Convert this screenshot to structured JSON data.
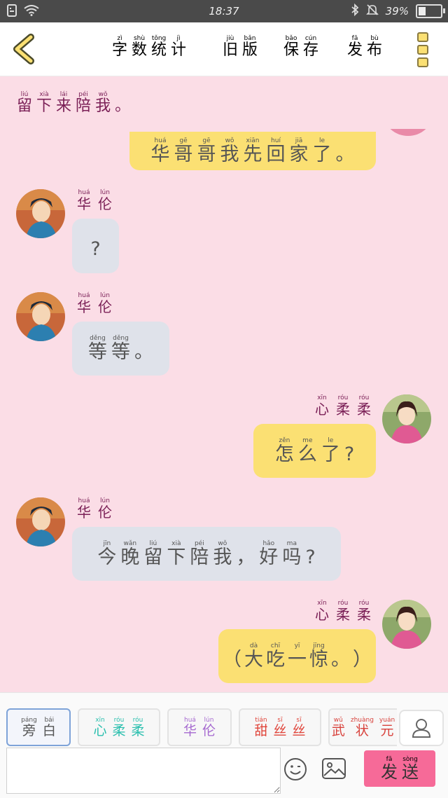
{
  "status_bar": {
    "time": "18:37",
    "battery": "39%",
    "battery_level": 0.39
  },
  "header": {
    "items": [
      {
        "chars": [
          {
            "py": "zì",
            "hz": "字"
          },
          {
            "py": "shù",
            "hz": "数"
          },
          {
            "py": "tǒng",
            "hz": "统"
          },
          {
            "py": "jì",
            "hz": "计"
          }
        ]
      },
      {
        "chars": [
          {
            "py": "jiù",
            "hz": "旧"
          },
          {
            "py": "bǎn",
            "hz": "版"
          }
        ]
      },
      {
        "chars": [
          {
            "py": "bǎo",
            "hz": "保"
          },
          {
            "py": "cún",
            "hz": "存"
          }
        ]
      },
      {
        "chars": [
          {
            "py": "fā",
            "hz": "发"
          },
          {
            "py": "bù",
            "hz": "布"
          }
        ]
      }
    ]
  },
  "intro": [
    {
      "py": "liú",
      "hz": "留"
    },
    {
      "py": "xià",
      "hz": "下"
    },
    {
      "py": "lái",
      "hz": "来"
    },
    {
      "py": "péi",
      "hz": "陪"
    },
    {
      "py": "wǒ",
      "hz": "我"
    },
    {
      "py": "",
      "hz": "。"
    }
  ],
  "names": {
    "hualun": [
      {
        "py": "huá",
        "hz": "华"
      },
      {
        "py": "lún",
        "hz": "伦"
      }
    ],
    "xinrourou": [
      {
        "py": "xīn",
        "hz": "心"
      },
      {
        "py": "róu",
        "hz": "柔"
      },
      {
        "py": "róu",
        "hz": "柔"
      }
    ]
  },
  "messages": [
    {
      "side": "right",
      "chars": [
        {
          "py": "huá",
          "hz": "华"
        },
        {
          "py": "gē",
          "hz": "哥"
        },
        {
          "py": "gē",
          "hz": "哥"
        },
        {
          "py": "wǒ",
          "hz": "我"
        },
        {
          "py": "xiān",
          "hz": "先"
        },
        {
          "py": "huí",
          "hz": "回"
        },
        {
          "py": "jiā",
          "hz": "家"
        },
        {
          "py": "le",
          "hz": "了"
        },
        {
          "py": "",
          "hz": "。"
        }
      ]
    },
    {
      "side": "left",
      "chars": [
        {
          "py": "",
          "hz": "?"
        }
      ]
    },
    {
      "side": "left",
      "chars": [
        {
          "py": "děng",
          "hz": "等"
        },
        {
          "py": "děng",
          "hz": "等"
        },
        {
          "py": "",
          "hz": "。"
        }
      ]
    },
    {
      "side": "right",
      "chars": [
        {
          "py": "zěn",
          "hz": "怎"
        },
        {
          "py": "me",
          "hz": "么"
        },
        {
          "py": "le",
          "hz": "了"
        },
        {
          "py": "",
          "hz": "?"
        }
      ]
    },
    {
      "side": "left",
      "chars": [
        {
          "py": "jīn",
          "hz": "今"
        },
        {
          "py": "wǎn",
          "hz": "晚"
        },
        {
          "py": "liú",
          "hz": "留"
        },
        {
          "py": "xià",
          "hz": "下"
        },
        {
          "py": "péi",
          "hz": "陪"
        },
        {
          "py": "wǒ",
          "hz": "我"
        },
        {
          "py": "",
          "hz": "，"
        },
        {
          "py": "hǎo",
          "hz": "好"
        },
        {
          "py": "ma",
          "hz": "吗"
        },
        {
          "py": "",
          "hz": "?"
        }
      ]
    },
    {
      "side": "right",
      "chars": [
        {
          "py": "",
          "hz": "（"
        },
        {
          "py": "dà",
          "hz": "大"
        },
        {
          "py": "chī",
          "hz": "吃"
        },
        {
          "py": "yī",
          "hz": "一"
        },
        {
          "py": "jīng",
          "hz": "惊"
        },
        {
          "py": "",
          "hz": "。"
        },
        {
          "py": "",
          "hz": "）"
        }
      ]
    }
  ],
  "roles": [
    {
      "chars": [
        {
          "py": "páng",
          "hz": "旁"
        },
        {
          "py": "bái",
          "hz": "白"
        }
      ],
      "color": "#555555"
    },
    {
      "chars": [
        {
          "py": "xīn",
          "hz": "心"
        },
        {
          "py": "róu",
          "hz": "柔"
        },
        {
          "py": "róu",
          "hz": "柔"
        }
      ],
      "color": "#2bbfae"
    },
    {
      "chars": [
        {
          "py": "huá",
          "hz": "华"
        },
        {
          "py": "lún",
          "hz": "伦"
        }
      ],
      "color": "#a66ad0"
    },
    {
      "chars": [
        {
          "py": "tián",
          "hz": "甜"
        },
        {
          "py": "sī",
          "hz": "丝"
        },
        {
          "py": "sī",
          "hz": "丝"
        }
      ],
      "color": "#e0443a"
    },
    {
      "chars": [
        {
          "py": "wǔ",
          "hz": "武"
        },
        {
          "py": "zhuàng",
          "hz": "状"
        },
        {
          "py": "yuán",
          "hz": "元"
        }
      ],
      "color": "#d8423c"
    }
  ],
  "send": [
    {
      "py": "fā",
      "hz": "发"
    },
    {
      "py": "sòng",
      "hz": "送"
    }
  ],
  "input": {
    "value": ""
  }
}
